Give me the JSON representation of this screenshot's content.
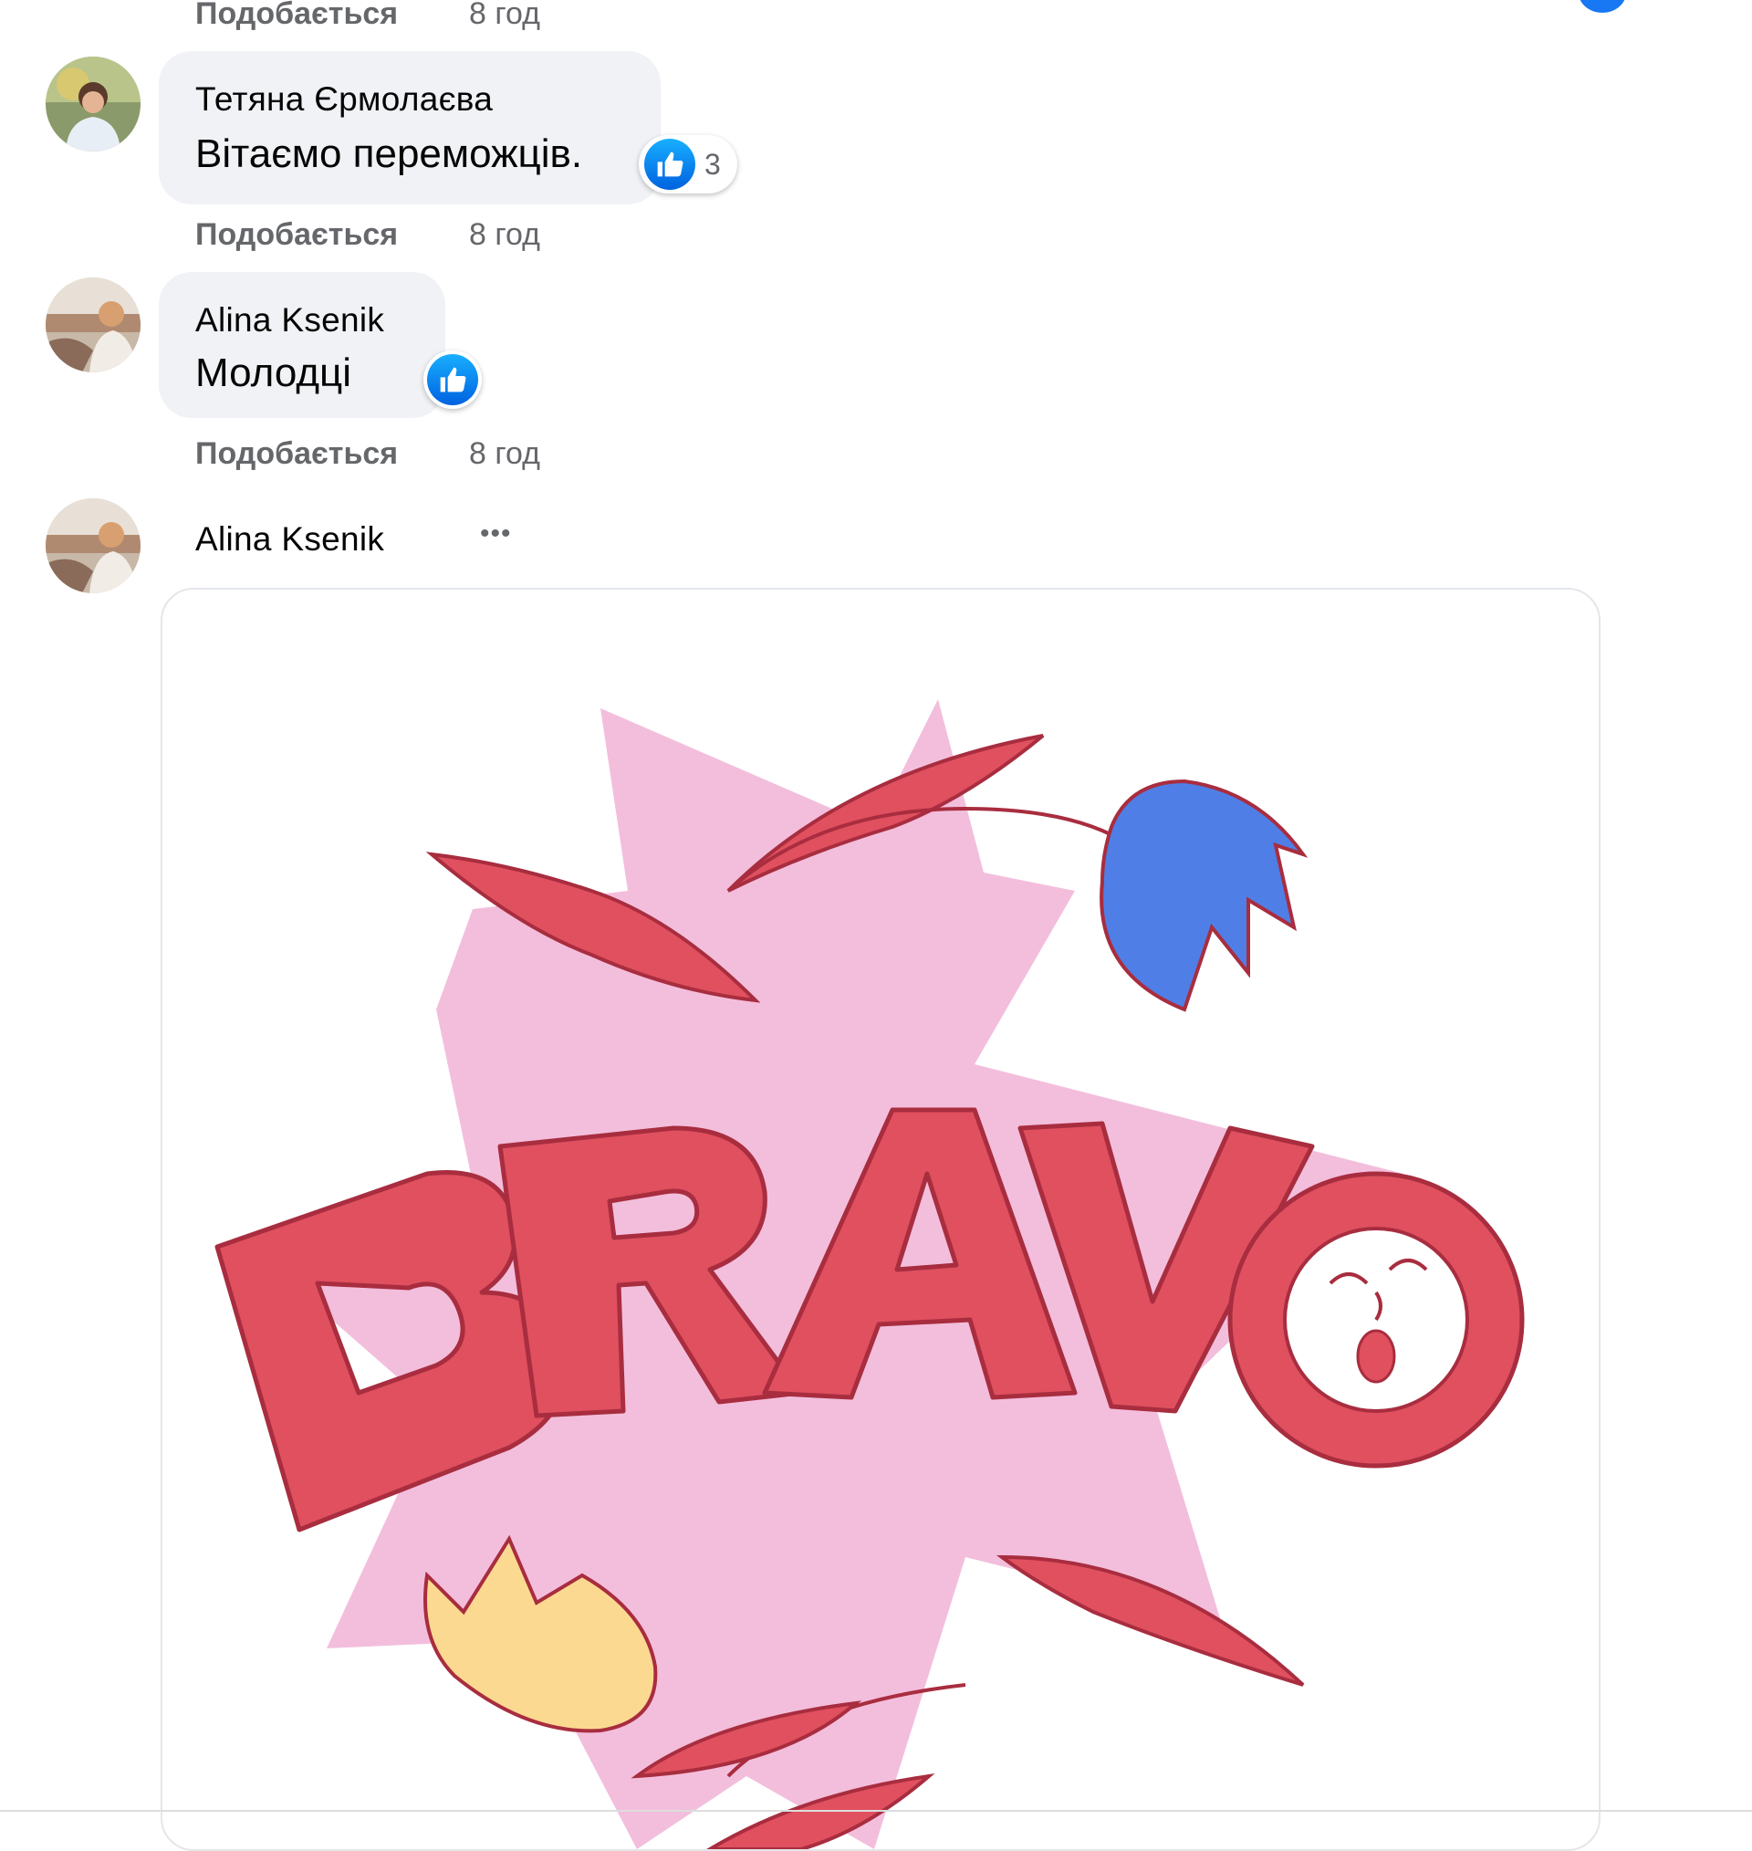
{
  "comments": [
    {
      "like_action": "Подобається",
      "time": "8 год"
    },
    {
      "author": "Тетяна Єрмолаєва",
      "text": "Вітаємо переможців.",
      "reaction_count": "3",
      "like_action": "Подобається",
      "time": "8 год"
    },
    {
      "author": "Alina Ksenik",
      "text": "Молодці",
      "like_action": "Подобається",
      "time": "8 год"
    },
    {
      "author": "Alina Ksenik",
      "more_label": "•••",
      "sticker": {
        "text": "BRAVO",
        "icon": "bravo-sticker"
      }
    }
  ],
  "colors": {
    "like_blue": "#1877f2",
    "bubble_bg": "#f0f2f5",
    "meta_gray": "#65676b",
    "sticker_red": "#e0505f",
    "sticker_pink": "#f0b8d8",
    "sticker_blue": "#4f7fe6",
    "sticker_yellow": "#fcd990"
  }
}
